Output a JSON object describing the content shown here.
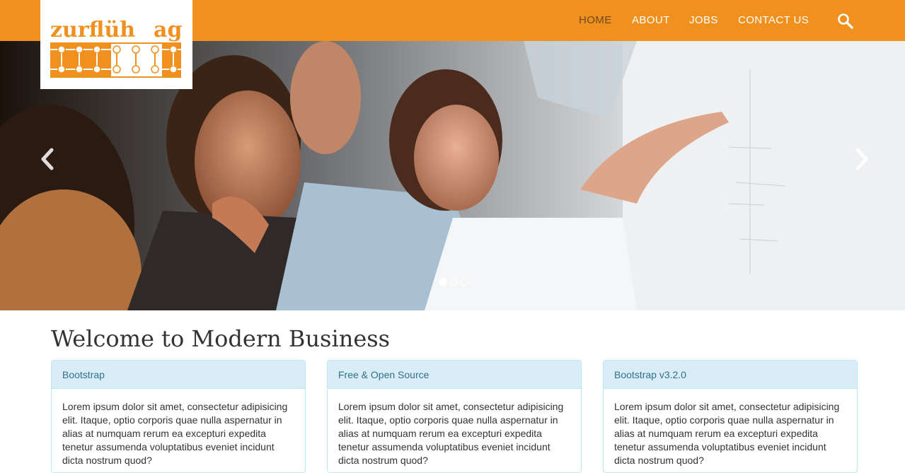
{
  "brand": {
    "logo_text_left": "zurflüh",
    "logo_text_right": "ag",
    "accent_color": "#f0901e",
    "logo_icon": "fence-logo-icon"
  },
  "nav": {
    "items": [
      {
        "label": "HOME",
        "active": true
      },
      {
        "label": "ABOUT",
        "active": false
      },
      {
        "label": "JOBS",
        "active": false
      },
      {
        "label": "CONTACT US",
        "active": false
      }
    ],
    "search_icon": "search-icon"
  },
  "carousel": {
    "prev_icon": "chevron-left-icon",
    "next_icon": "chevron-right-icon",
    "slide_count": 3,
    "active_slide": 1
  },
  "main": {
    "title": "Welcome to Modern Business",
    "panels": [
      {
        "heading": "Bootstrap",
        "body": "Lorem ipsum dolor sit amet, consectetur adipisicing elit. Itaque, optio corporis quae nulla aspernatur in alias at numquam rerum ea excepturi expedita tenetur assumenda voluptatibus eveniet incidunt dicta nostrum quod?"
      },
      {
        "heading": "Free & Open Source",
        "body": "Lorem ipsum dolor sit amet, consectetur adipisicing elit. Itaque, optio corporis quae nulla aspernatur in alias at numquam rerum ea excepturi expedita tenetur assumenda voluptatibus eveniet incidunt dicta nostrum quod?"
      },
      {
        "heading": "Bootstrap v3.2.0",
        "body": "Lorem ipsum dolor sit amet, consectetur adipisicing elit. Itaque, optio corporis quae nulla aspernatur in alias at numquam rerum ea excepturi expedita tenetur assumenda voluptatibus eveniet incidunt dicta nostrum quod?"
      }
    ]
  }
}
